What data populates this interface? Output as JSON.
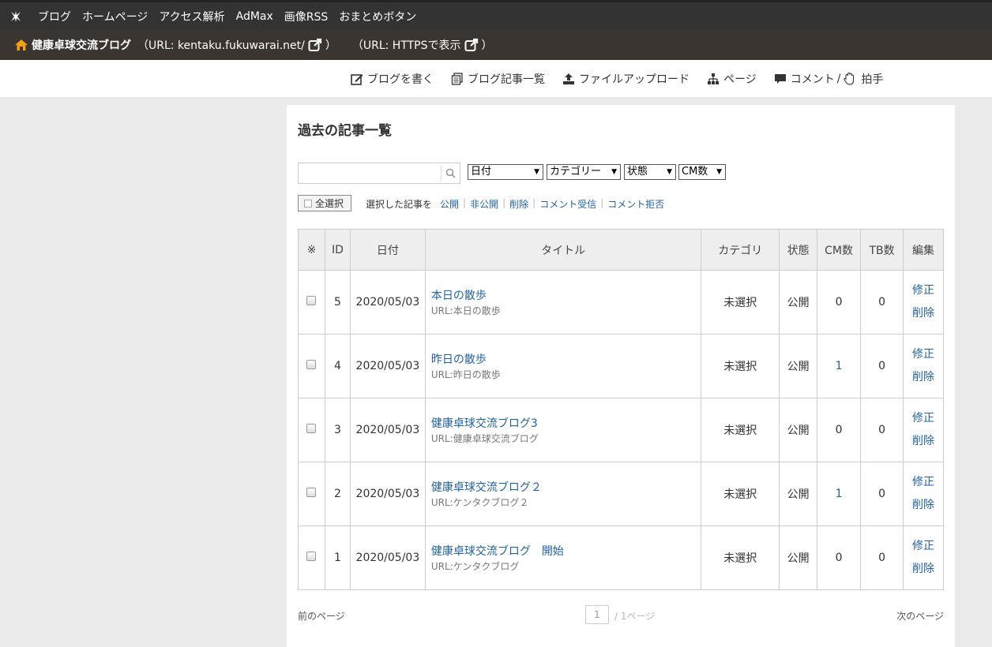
{
  "topnav": {
    "items": [
      "ブログ",
      "ホームページ",
      "アクセス解析",
      "AdMax",
      "画像RSS",
      "おまとめボタン"
    ]
  },
  "blogbar": {
    "blog_name": "健康卓球交流ブログ",
    "url_label": "（URL: kentaku.fukuwarai.net/",
    "url_close": "）",
    "https_label": "（URL: HTTPSで表示",
    "https_close": "）"
  },
  "subnav": {
    "write": "ブログを書く",
    "list": "ブログ記事一覧",
    "upload": "ファイルアップロード",
    "page": "ページ",
    "comment": "コメント",
    "sep": "/",
    "clap": "拍手"
  },
  "main": {
    "title": "過去の記事一覧",
    "search_value": "",
    "filters": {
      "date": "日付",
      "category": "カテゴリー",
      "status": "状態",
      "cm": "CM数"
    },
    "select_all": "全選択",
    "bulk_label": "選択した記事を",
    "bulk_actions": [
      "公開",
      "非公開",
      "削除",
      "コメント受信",
      "コメント拒否"
    ]
  },
  "table": {
    "headers": [
      "※",
      "ID",
      "日付",
      "タイトル",
      "カテゴリ",
      "状態",
      "CM数",
      "TB数",
      "編集"
    ],
    "rows": [
      {
        "id": "5",
        "date": "2020/05/03",
        "title": "本日の散歩",
        "url": "URL:本日の散歩",
        "category": "未選択",
        "status": "公開",
        "cm": "0",
        "tb": "0"
      },
      {
        "id": "4",
        "date": "2020/05/03",
        "title": "昨日の散歩",
        "url": "URL:昨日の散歩",
        "category": "未選択",
        "status": "公開",
        "cm": "1",
        "tb": "0"
      },
      {
        "id": "3",
        "date": "2020/05/03",
        "title": "健康卓球交流ブログ3",
        "url": "URL:健康卓球交流ブログ",
        "category": "未選択",
        "status": "公開",
        "cm": "0",
        "tb": "0"
      },
      {
        "id": "2",
        "date": "2020/05/03",
        "title": "健康卓球交流ブログ２",
        "url": "URL:ケンタクブログ２",
        "category": "未選択",
        "status": "公開",
        "cm": "1",
        "tb": "0"
      },
      {
        "id": "1",
        "date": "2020/05/03",
        "title": "健康卓球交流ブログ　開始",
        "url": "URL:ケンタクブログ",
        "category": "未選択",
        "status": "公開",
        "cm": "0",
        "tb": "0"
      }
    ],
    "edit_label": "修正",
    "delete_label": "削除"
  },
  "pager": {
    "prev": "前のページ",
    "current": "1",
    "total": "/ 1ページ",
    "next": "次のページ"
  },
  "colors": {
    "link": "#2262a8",
    "topnav_bg": "#333333",
    "blogbar_bg": "#3b3531",
    "home_icon": "#f0a11b"
  }
}
